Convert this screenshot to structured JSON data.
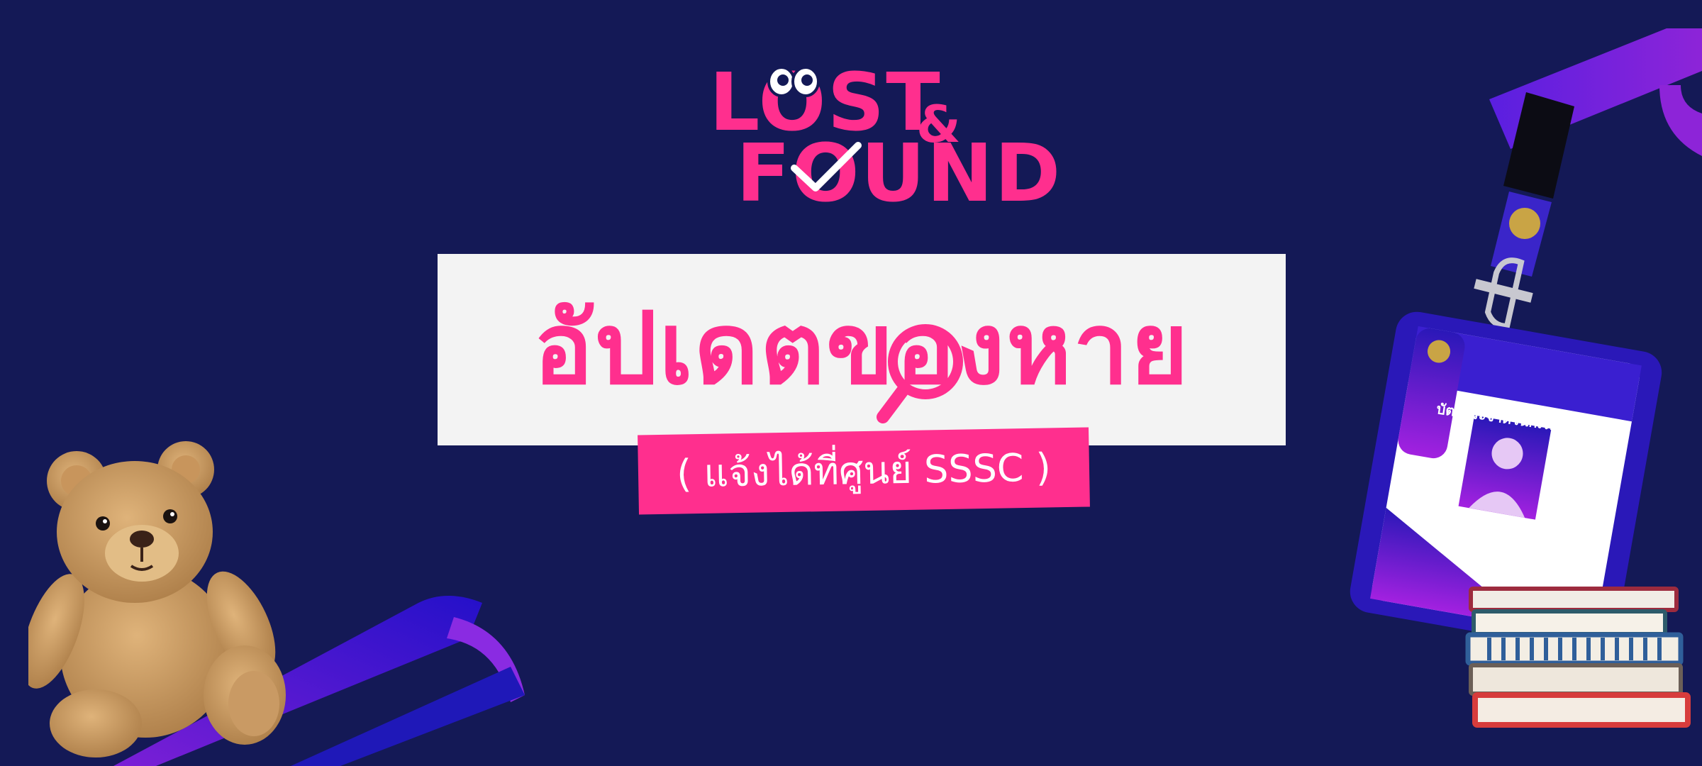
{
  "logo": {
    "line1": "LOST",
    "amp": "&",
    "line2": "FOUND"
  },
  "title": "อัปเดตของหาย",
  "subtitle": "( แจ้งได้ที่ศูนย์ SSSC )",
  "id_card": {
    "label": "บัตรประจำตัวนักเรียน"
  },
  "colors": {
    "background": "#141956",
    "accent": "#ff2f8e",
    "panel": "#f3f3f3",
    "purple": "#7b2cff"
  }
}
